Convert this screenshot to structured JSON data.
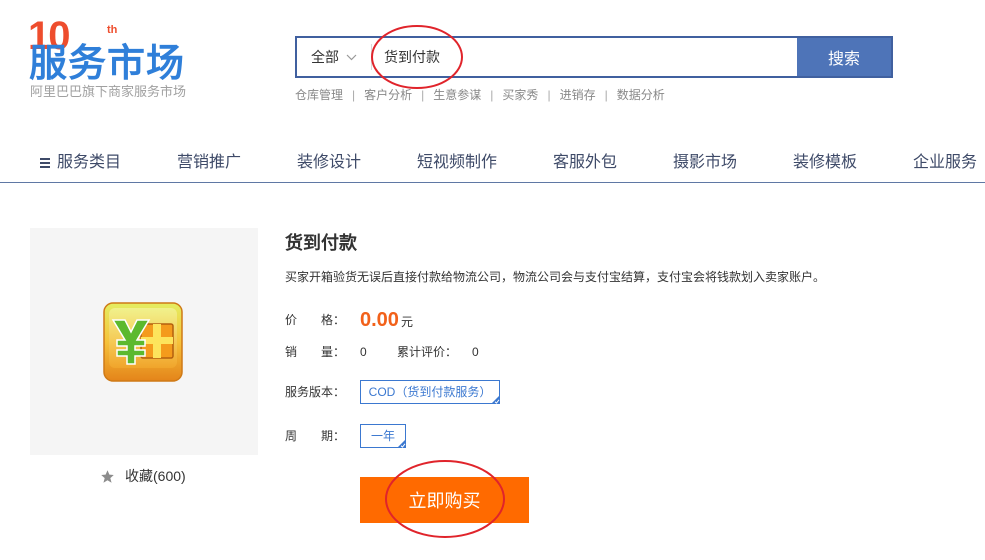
{
  "logo": {
    "anniversary_number": "10",
    "anniversary_suffix": "th",
    "title": "服务市场",
    "subtitle": "阿里巴巴旗下商家服务市场"
  },
  "search": {
    "category": "全部",
    "category_icon": "chevron-down-icon",
    "value": "货到付款",
    "button_label": "搜索",
    "hot_links": [
      "仓库管理",
      "客户分析",
      "生意参谋",
      "买家秀",
      "进销存",
      "数据分析"
    ],
    "separator": "|"
  },
  "nav": {
    "menu_icon": "menu-icon",
    "items": [
      "服务类目",
      "营销推广",
      "装修设计",
      "短视频制作",
      "客服外包",
      "摄影市场",
      "装修模板",
      "企业服务"
    ]
  },
  "product": {
    "image_icon": "cod-payment-icon",
    "favorite_icon": "star-icon",
    "favorite_label": "收藏(600)",
    "title": "货到付款",
    "description": "买家开箱验货无误后直接付款给物流公司，物流公司会与支付宝结算，支付宝会将钱款划入卖家账户。",
    "price_label": "价　　格：",
    "price": "0.00",
    "currency": "元",
    "sales_label": "销　　量：",
    "sales": "0",
    "reviews_label": "累计评价：",
    "reviews": "0",
    "version_label": "服务版本：",
    "version_option": "COD（货到付款服务）",
    "period_label": "周　　期：",
    "period_option": "一年",
    "buy_label": "立即购买"
  },
  "colors": {
    "logo_blue": "#2f7fd9",
    "anniversary_red": "#ee4d2d",
    "search_border": "#40609f",
    "search_button": "#4e74b8",
    "nav_text": "#3e4a68",
    "nav_divider": "#5f78a4",
    "price_orange": "#f2611a",
    "option_blue": "#3b78d0",
    "buy_button": "#ff6a00",
    "annotation_red": "#e0242b"
  }
}
